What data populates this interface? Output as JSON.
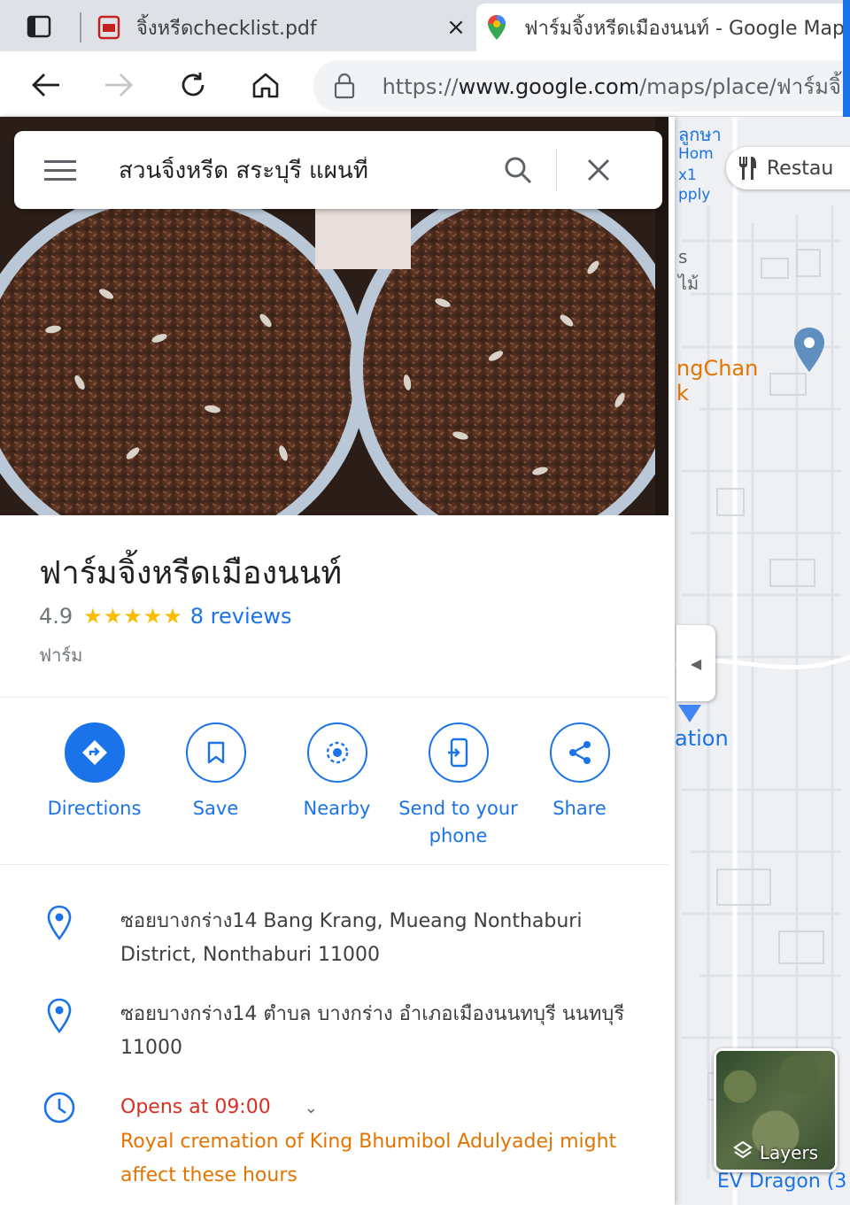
{
  "browser": {
    "tabs": [
      {
        "title": "จิ้งหรีดchecklist.pdf",
        "icon": "pdf-icon",
        "active": false
      },
      {
        "title": "ฟาร์มจิ้งหรีดเมืองนนท์ - Google Maps",
        "icon": "google-maps-icon",
        "active": true
      }
    ],
    "tab_close": "×",
    "url_prefix": "https://",
    "url_domain": "www.google.com",
    "url_path": "/maps/place/ฟาร์มจิ้งหรีด"
  },
  "search": {
    "value": "สวนจิ้งหรีด สระบุรี แผนที่"
  },
  "place": {
    "title": "ฟาร์มจิ้งหรีดเมืองนนท์",
    "rating": "4.9",
    "stars": "★★★★★",
    "reviews": "8 reviews",
    "category": "ฟาร์ม"
  },
  "actions": [
    {
      "label": "Directions"
    },
    {
      "label": "Save"
    },
    {
      "label": "Nearby"
    },
    {
      "label": "Send to your phone"
    },
    {
      "label": "Share"
    }
  ],
  "info": {
    "address_en": "ซอยบางกร่าง14 Bang Krang, Mueang Nonthaburi District, Nonthaburi 11000",
    "address_th": "ซอยบางกร่าง14 ตำบล บางกร่าง อำเภอเมืองนนทบุรี นนทบุรี 11000",
    "hours": "Opens at 09:00",
    "hours_note": "Royal cremation of King Bhumibol Adulyadej might affect these hours"
  },
  "map": {
    "chip_restaurant": "Restau",
    "labels": [
      "ลูกษา",
      "Hom",
      "x1",
      "pply",
      "s",
      "ไม้",
      "ngChan",
      "k",
      "ation",
      "EV Dragon (3"
    ],
    "layers": "Layers"
  },
  "colors": {
    "accent": "#1a73e8",
    "star": "#fbbc04",
    "open_red": "#d93025",
    "warning_orange": "#e37400"
  }
}
